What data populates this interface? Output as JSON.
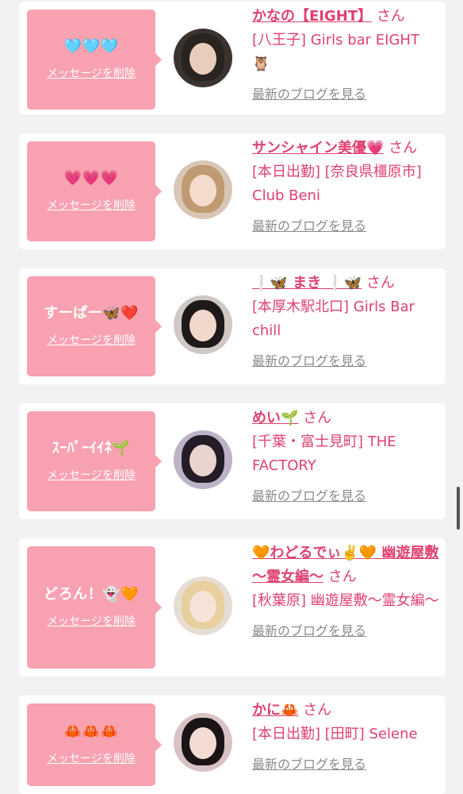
{
  "entries": [
    {
      "message": "🩵🩵🩵",
      "delete_label": "メッセージを削除",
      "name": "かなの【EIGHT】",
      "honorific": "さん",
      "shop": "[八王子] Girls bar EIGHT 🦉",
      "blog_label": "最新のブログを見る"
    },
    {
      "message": "💗💗💗",
      "delete_label": "メッセージを削除",
      "name": "サンシャイン美優💗",
      "honorific": "さん",
      "shop": "[本日出勤] [奈良県橿原市] Club Beni",
      "blog_label": "最新のブログを見る"
    },
    {
      "message": "すーぱー🦋❤️",
      "delete_label": "メッセージを削除",
      "name": "❕🦋 まき ❕🦋",
      "honorific": "さん",
      "shop": "[本厚木駅北口] Girls Bar chill",
      "blog_label": "最新のブログを見る"
    },
    {
      "message": "ｽｰﾊﾟｰｲｲﾈ🌱",
      "delete_label": "メッセージを削除",
      "name": "めい🌱",
      "honorific": "さん",
      "shop": "[千葉・富士見町] THE FACTORY",
      "blog_label": "最新のブログを見る"
    },
    {
      "message": "どろん！👻🧡",
      "delete_label": "メッセージを削除",
      "name": "🧡わどるでぃ✌️🧡 幽遊屋敷 〜霊女編〜",
      "honorific": "さん",
      "shop": "[秋葉原] 幽遊屋敷〜霊女編〜",
      "blog_label": "最新のブログを見る"
    },
    {
      "message": "🦀🦀🦀",
      "delete_label": "メッセージを削除",
      "name": "かに🦀",
      "honorific": "さん",
      "shop": "[本日出勤] [田町] Selene",
      "blog_label": "最新のブログを見る"
    }
  ],
  "colors": {
    "accent": "#e0416f",
    "message_box": "#f8a2b1",
    "card": "#ffffff",
    "background": "#f2f2f2",
    "blog_link": "#8a8a8a"
  }
}
